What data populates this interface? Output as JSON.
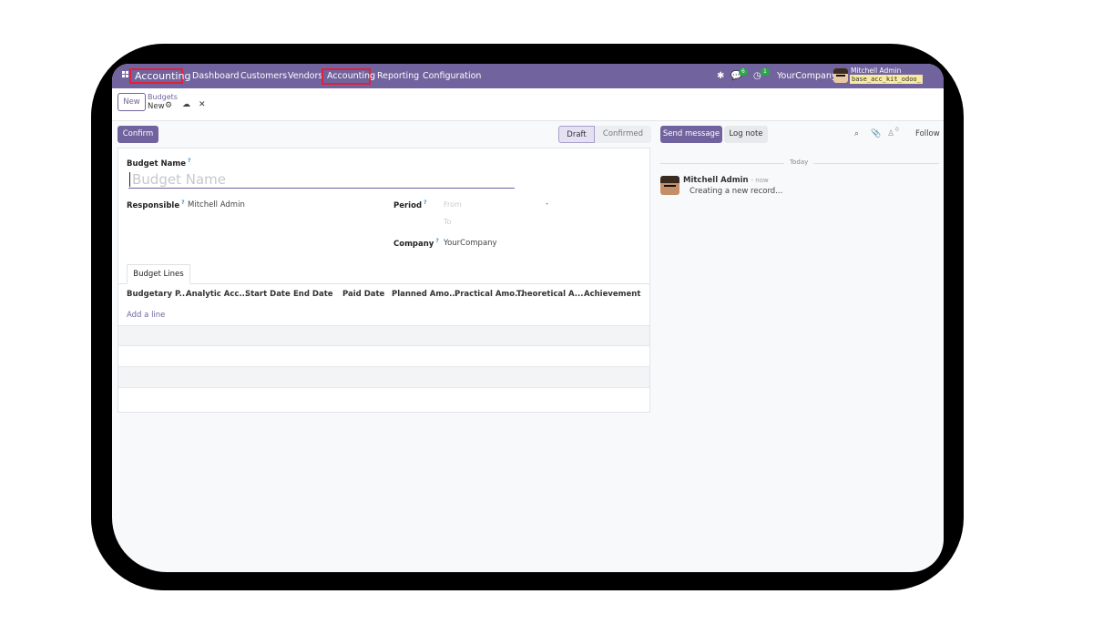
{
  "navbar": {
    "app_name": "Accounting",
    "menu": [
      "Dashboard",
      "Customers",
      "Vendors",
      "Accounting",
      "Reporting",
      "Configuration"
    ],
    "messages_count": "6",
    "activities_count": "1",
    "company": "YourCompany",
    "user_name": "Mitchell Admin",
    "database": "base_acc_kit_odoo_",
    "highlight_color": "#e0213a",
    "bg_color": "#71639e"
  },
  "control_panel": {
    "new_label": "New",
    "breadcrumb_parent": "Budgets",
    "breadcrumb_current": "New"
  },
  "statusbar": {
    "confirm_label": "Confirm",
    "stages": [
      "Draft",
      "Confirmed"
    ],
    "active_stage": "Draft"
  },
  "form": {
    "budget_name_label": "Budget Name",
    "budget_name_placeholder": "Budget Name",
    "responsible_label": "Responsible",
    "responsible_value": "Mitchell Admin",
    "period_label": "Period",
    "period_from_placeholder": "From",
    "period_separator": "-",
    "period_to_placeholder": "To",
    "company_label": "Company",
    "company_value": "YourCompany",
    "help_mark": "?"
  },
  "tabs": [
    "Budget Lines"
  ],
  "table": {
    "columns": [
      "Budgetary P...",
      "Analytic Acc...",
      "Start Date",
      "End Date",
      "Paid Date",
      "Planned Amo...",
      "Practical Amo...",
      "Theoretical A...",
      "Achievement"
    ],
    "add_line": "Add a line"
  },
  "chatter": {
    "send_message": "Send message",
    "log_note": "Log note",
    "followers_count": "0",
    "follow": "Follow",
    "date_separator": "Today",
    "messages": [
      {
        "author": "Mitchell Admin",
        "time": "- now",
        "body": "Creating a new record..."
      }
    ]
  }
}
